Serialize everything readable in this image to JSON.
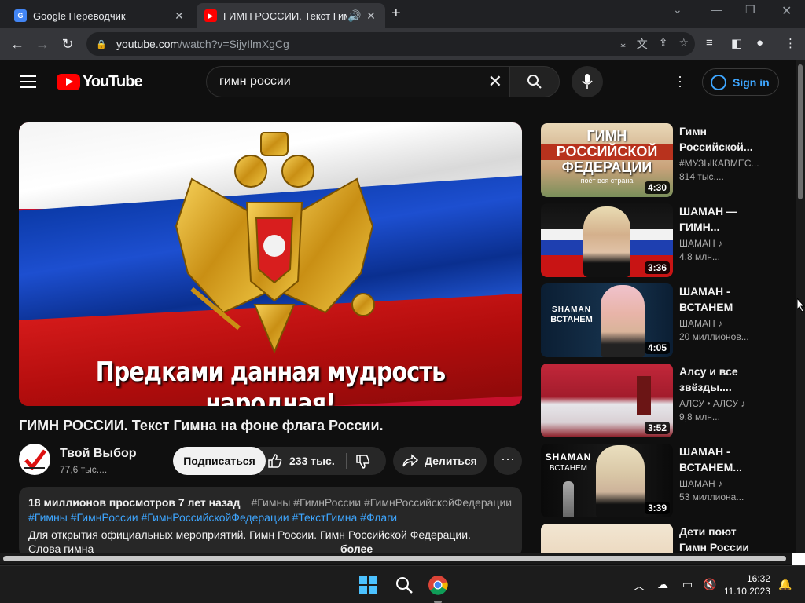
{
  "browser": {
    "tabs": [
      {
        "title": "Google Переводчик",
        "favicon": "google-translate-icon",
        "active": false
      },
      {
        "title": "ГИМН РОССИИ. Текст Гимн",
        "favicon": "youtube-icon",
        "active": true
      }
    ],
    "url_host": "youtube.com",
    "url_path": "/watch?v=SijyIlmXgCg"
  },
  "youtube": {
    "logo": "YouTube",
    "search_query": "гимн россии",
    "signin_label": "Sign in"
  },
  "video": {
    "caption": "Предками данная мудрость народная!",
    "title": "ГИМН РОССИИ. Текст Гимна на фоне флага России.",
    "channel_name": "Твой Выбор",
    "channel_subs": "77,6 тыс....",
    "subscribe_label": "Подписаться",
    "likes": "233 тыс.",
    "share_label": "Делиться",
    "description": {
      "views_date": "18 миллионов просмотров 7 лет назад",
      "tags_line1": "#Гимны #ГимнРоссии #ГимнРоссийскойФедерации",
      "tags_line2": "#Гимны #ГимнРоссии #ГимнРоссийскойФедерации #ТекстГимна #Флаги",
      "text_line1": "Для открытия официальных мероприятий. Гимн России. Гимн Российской Федерации.",
      "text_line2_start": "Слова гимна",
      "text_line2_more": "более"
    }
  },
  "recommendations": [
    {
      "title": "Гимн Российской...",
      "channel": "#МУЗЫКАВМЕС...",
      "views": "814 тыс....",
      "duration": "4:30",
      "thumb_text": [
        "ГИМН",
        "РОССИЙСКОЙ",
        "ФЕДЕРАЦИИ"
      ],
      "thumb_sub": "поёт вся страна"
    },
    {
      "title": "ШАМАН — ГИМН...",
      "channel": "ШАМАН ♪",
      "views": "4,8 млн...",
      "duration": "3:36"
    },
    {
      "title": "ШАМАН - ВСТАНЕМ",
      "channel": "ШАМАН ♪",
      "views": "20 миллионов...",
      "duration": "4:05",
      "thumb_text": [
        "SHAMAN",
        "ВСТАНЕМ"
      ]
    },
    {
      "title": "Алсу и все звёзды....",
      "channel": "АЛСУ • АЛСУ ♪",
      "views": "9,8 млн...",
      "duration": "3:52"
    },
    {
      "title": "ШАМАН - ВСТАНЕМ...",
      "channel": "ШАМАН ♪",
      "views": "53 миллиона...",
      "duration": "3:39",
      "thumb_text": [
        "SHAMAN",
        "ВСТАНЕМ"
      ]
    },
    {
      "title": "Дети поют Гимн России",
      "channel": "",
      "views": "",
      "duration": ""
    }
  ],
  "taskbar": {
    "time": "16:32",
    "date": "11.10.2023"
  },
  "colors": {
    "yt_red": "#ff0000",
    "link_blue": "#3ea6ff",
    "bg": "#0f0f0f"
  }
}
